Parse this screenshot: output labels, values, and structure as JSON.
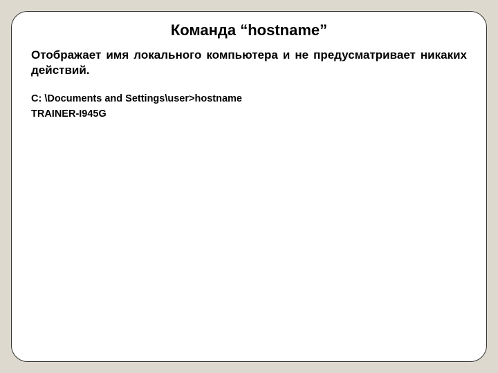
{
  "slide": {
    "title": "Команда “hostname”",
    "description": "Отображает имя локального компьютера и не предусматривает никаких действий.",
    "command_prompt": "C: \\Documents and Settings\\user>hostname",
    "command_output": "TRAINER-I945G"
  }
}
